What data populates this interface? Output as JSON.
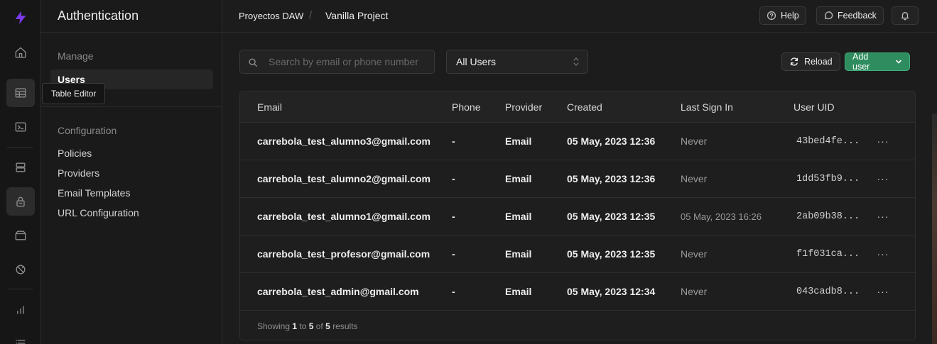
{
  "rail": {
    "items": [
      {
        "name": "home-icon"
      },
      {
        "name": "table-editor-icon"
      },
      {
        "name": "sql-editor-icon"
      },
      {
        "name": "database-icon"
      },
      {
        "name": "authentication-icon"
      },
      {
        "name": "storage-icon"
      },
      {
        "name": "realtime-icon"
      },
      {
        "name": "reports-icon"
      },
      {
        "name": "logs-icon"
      }
    ],
    "tooltip": "Table Editor"
  },
  "menu": {
    "title": "Authentication",
    "manage_heading": "Manage",
    "manage_items": [
      "Users"
    ],
    "config_heading": "Configuration",
    "config_items": [
      "Policies",
      "Providers",
      "Email Templates",
      "URL Configuration"
    ]
  },
  "topbar": {
    "org": "Proyectos DAW",
    "separator": "/",
    "project": "Vanilla Project",
    "help_label": "Help",
    "feedback_label": "Feedback"
  },
  "toolbar": {
    "search_placeholder": "Search by email or phone number",
    "filter_value": "All Users",
    "reload_label": "Reload",
    "add_user_label": "Add user"
  },
  "table": {
    "columns": [
      "Email",
      "Phone",
      "Provider",
      "Created",
      "Last Sign In",
      "User UID"
    ],
    "rows": [
      {
        "email": "carrebola_test_alumno3@gmail.com",
        "phone": "-",
        "provider": "Email",
        "created": "05 May, 2023 12:36",
        "last_sign_in": "Never",
        "uid": "43bed4fe..."
      },
      {
        "email": "carrebola_test_alumno2@gmail.com",
        "phone": "-",
        "provider": "Email",
        "created": "05 May, 2023 12:36",
        "last_sign_in": "Never",
        "uid": "1dd53fb9..."
      },
      {
        "email": "carrebola_test_alumno1@gmail.com",
        "phone": "-",
        "provider": "Email",
        "created": "05 May, 2023 12:35",
        "last_sign_in": "05 May, 2023 16:26",
        "uid": "2ab09b38..."
      },
      {
        "email": "carrebola_test_profesor@gmail.com",
        "phone": "-",
        "provider": "Email",
        "created": "05 May, 2023 12:35",
        "last_sign_in": "Never",
        "uid": "f1f031ca..."
      },
      {
        "email": "carrebola_test_admin@gmail.com",
        "phone": "-",
        "provider": "Email",
        "created": "05 May, 2023 12:34",
        "last_sign_in": "Never",
        "uid": "043cadb8..."
      }
    ],
    "row_menu_label": "···",
    "footer": {
      "prefix": "Showing",
      "from": "1",
      "to_word": "to",
      "to": "5",
      "of_word": "of",
      "total": "5",
      "suffix": "results"
    }
  },
  "colors": {
    "accent": "#3ecf8e",
    "add_user_bg": "#2f8c5e",
    "logo": "#7c3aed"
  }
}
